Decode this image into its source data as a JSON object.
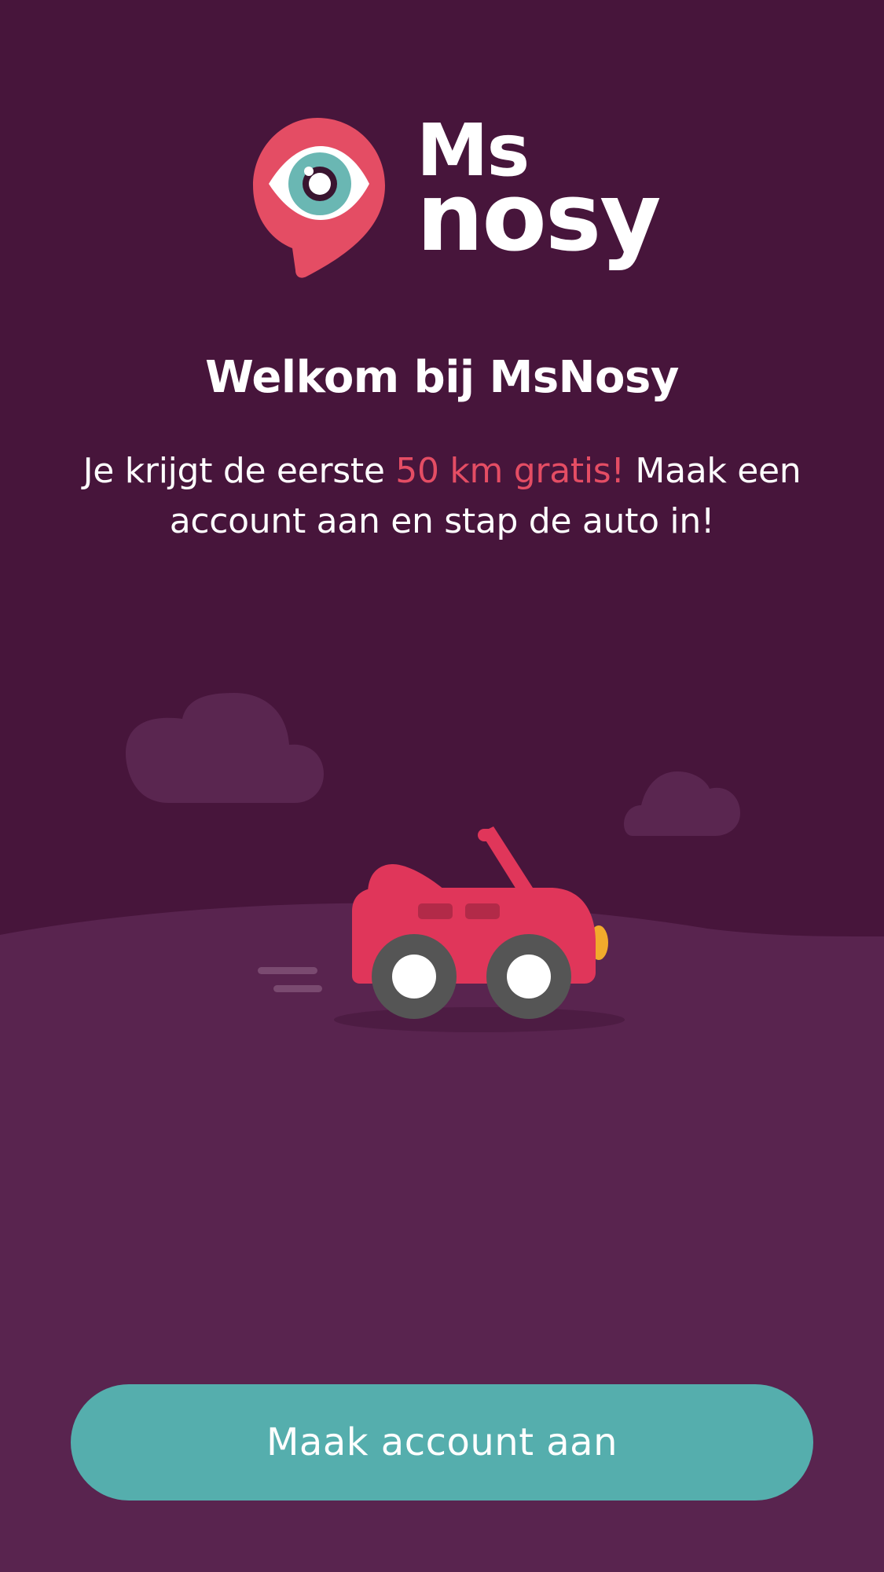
{
  "brand": {
    "logo_line1": "Ms",
    "logo_line2": "nosy",
    "logo_icon": "eye-pin-icon"
  },
  "welcome": {
    "title": "Welkom bij MsNosy",
    "text_before": "Je krijgt de eerste ",
    "text_highlight": "50 km gratis!",
    "text_after": " Maak een account aan en stap de auto in!"
  },
  "illustration": {
    "car": "car-icon",
    "clouds": [
      "cloud-icon",
      "cloud-icon"
    ],
    "speed_lines": "speed-lines-icon"
  },
  "actions": {
    "create_account_label": "Maak account aan"
  },
  "colors": {
    "background_top": "#47153b",
    "background_ground": "#59244f",
    "accent_red": "#e44d64",
    "button_teal": "#55aead",
    "car_red": "#e0365a",
    "cloud": "#5a2650"
  }
}
